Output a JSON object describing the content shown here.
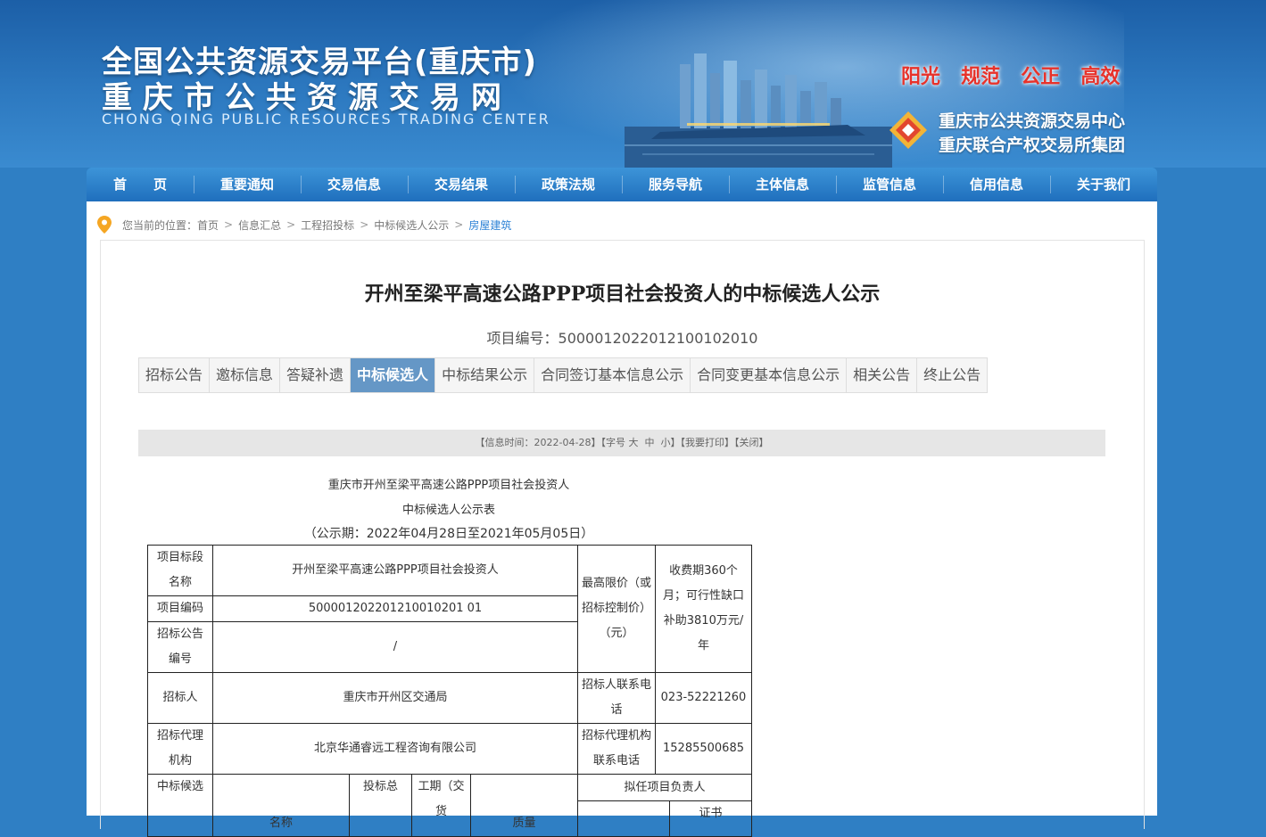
{
  "header": {
    "title_line1": "全国公共资源交易平台(重庆市)",
    "title_line2": "重庆市公共资源交易网",
    "title_english": "CHONG QING PUBLIC RESOURCES TRADING CENTER",
    "slogans": [
      "阳光",
      "规范",
      "公正",
      "高效"
    ],
    "org_line1": "重庆市公共资源交易中心",
    "org_line2": "重庆联合产权交易所集团"
  },
  "nav": {
    "items": [
      "首　　页",
      "重要通知",
      "交易信息",
      "交易结果",
      "政策法规",
      "服务导航",
      "主体信息",
      "监管信息",
      "信用信息",
      "关于我们"
    ]
  },
  "breadcrumb": {
    "prefix": "您当前的位置：",
    "items": [
      "首页",
      "信息汇总",
      "工程招投标",
      "中标候选人公示",
      "房屋建筑"
    ]
  },
  "document": {
    "title": "开州至梁平高速公路PPP项目社会投资人的中标候选人公示",
    "project_code": "项目编号：5000012022012100102010",
    "tabs": [
      "招标公告",
      "邀标信息",
      "答疑补遗",
      "中标候选人",
      "中标结果公示",
      "合同签订基本信息公示",
      "合同变更基本信息公示",
      "相关公告",
      "终止公告"
    ],
    "active_tab": "中标候选人"
  },
  "infobar": {
    "info_time": "【信息时间：2022-04-28】",
    "font_label": "【字号 ",
    "font_large": "大",
    "font_medium": "中",
    "font_small": "小",
    "font_end": "】",
    "print": "【我要打印】",
    "close": "【关闭】"
  },
  "notice": {
    "line1": "重庆市开州至梁平高速公路PPP项目社会投资人",
    "line2": "中标候选人公示表",
    "line3": "（公示期：2022年04月28日至2021年05月05日）"
  },
  "table": {
    "r1_label": "项目标段名称",
    "r1_value": "开州至梁平高速公路PPP项目社会投资人",
    "max_price_label": "最高限价（或招标控制价）（元）",
    "max_price_value": "收费期360个月；可行性缺口补助3810万元/年",
    "r2_label": "项目编码",
    "r2_value": "500001202201210010201 01",
    "r3_label": "招标公告编号",
    "r3_value": "/",
    "r4_label": "招标人",
    "r4_value": "重庆市开州区交通局",
    "r4_phone_label": "招标人联系电话",
    "r4_phone_value": "023-52221260",
    "r5_label": "招标代理机构",
    "r5_value": "北京华通睿远工程咨询有限公司",
    "r5_phone_label": "招标代理机构联系电话",
    "r5_phone_value": "15285500685",
    "r6_label": "中标候选",
    "r6_name": "名称",
    "r6_total": "投标总",
    "r6_period": "工期（交货",
    "r6_quality": "质量",
    "r6_manager": "拟任项目负责人",
    "r6_cert": "证书"
  }
}
